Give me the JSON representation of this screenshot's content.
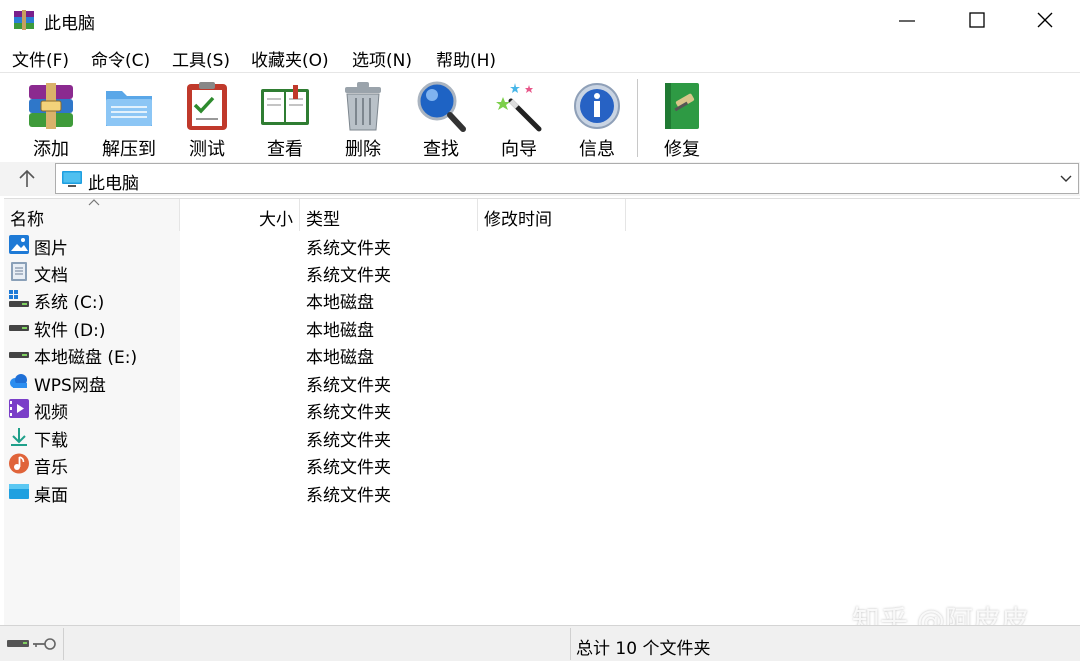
{
  "window": {
    "title": "此电脑"
  },
  "menu": [
    "文件(F)",
    "命令(C)",
    "工具(S)",
    "收藏夹(O)",
    "选项(N)",
    "帮助(H)"
  ],
  "toolbar": [
    {
      "label": "添加",
      "icon": "archive-add-icon"
    },
    {
      "label": "解压到",
      "icon": "folder-extract-icon"
    },
    {
      "label": "测试",
      "icon": "clipboard-check-icon"
    },
    {
      "label": "查看",
      "icon": "book-view-icon"
    },
    {
      "label": "删除",
      "icon": "trash-icon"
    },
    {
      "label": "查找",
      "icon": "magnifier-icon"
    },
    {
      "label": "向导",
      "icon": "magic-wand-icon"
    },
    {
      "label": "信息",
      "icon": "info-icon"
    },
    {
      "label": "修复",
      "icon": "repair-book-icon"
    }
  ],
  "address": {
    "path": "此电脑"
  },
  "columns": {
    "name": "名称",
    "size": "大小",
    "type": "类型",
    "modified": "修改时间"
  },
  "files": [
    {
      "name": "图片",
      "type": "系统文件夹",
      "icon": "pictures-icon"
    },
    {
      "name": "文档",
      "type": "系统文件夹",
      "icon": "documents-icon"
    },
    {
      "name": "系统 (C:)",
      "type": "本地磁盘",
      "icon": "system-drive-icon"
    },
    {
      "name": "软件 (D:)",
      "type": "本地磁盘",
      "icon": "drive-icon"
    },
    {
      "name": "本地磁盘 (E:)",
      "type": "本地磁盘",
      "icon": "drive-icon"
    },
    {
      "name": "WPS网盘",
      "type": "系统文件夹",
      "icon": "cloud-icon"
    },
    {
      "name": "视频",
      "type": "系统文件夹",
      "icon": "video-icon"
    },
    {
      "name": "下载",
      "type": "系统文件夹",
      "icon": "download-icon"
    },
    {
      "name": "音乐",
      "type": "系统文件夹",
      "icon": "music-icon"
    },
    {
      "name": "桌面",
      "type": "系统文件夹",
      "icon": "desktop-icon"
    }
  ],
  "status": {
    "summary": "总计 10 个文件夹"
  },
  "watermark": "知乎 @阿皮皮"
}
